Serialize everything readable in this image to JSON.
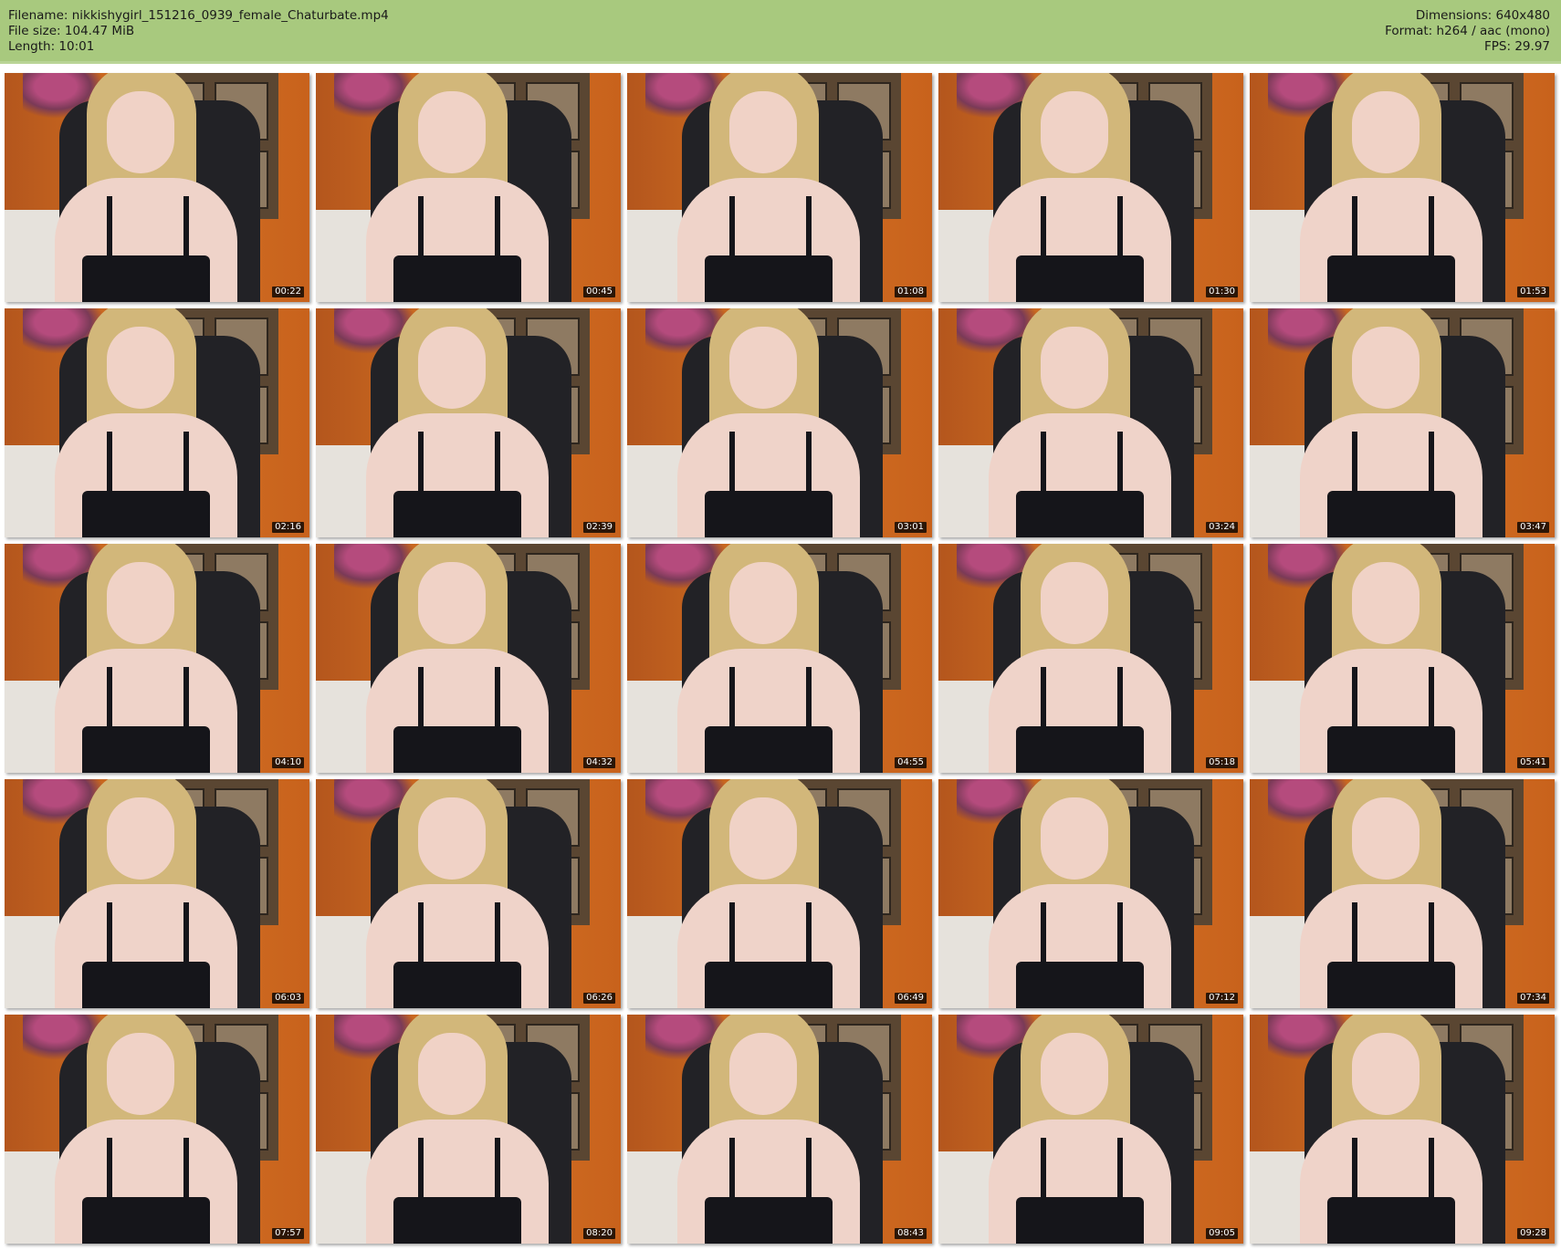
{
  "header": {
    "filename": "Filename: nikkishygirl_151216_0939_female_Chaturbate.mp4",
    "filesize": "File size: 104.47 MiB",
    "length": "Length: 10:01",
    "dimensions": "Dimensions: 640x480",
    "format": "Format: h264 / aac (mono)",
    "fps": "FPS: 29.97"
  },
  "colors": {
    "header_bg": "#a8c97e",
    "timestamp_bg": "#000000",
    "timestamp_text": "#ffffff"
  },
  "thumbnails": [
    {
      "timestamp": "00:22"
    },
    {
      "timestamp": "00:45"
    },
    {
      "timestamp": "01:08"
    },
    {
      "timestamp": "01:30"
    },
    {
      "timestamp": "01:53"
    },
    {
      "timestamp": "02:16"
    },
    {
      "timestamp": "02:39"
    },
    {
      "timestamp": "03:01"
    },
    {
      "timestamp": "03:24"
    },
    {
      "timestamp": "03:47"
    },
    {
      "timestamp": "04:10"
    },
    {
      "timestamp": "04:32"
    },
    {
      "timestamp": "04:55"
    },
    {
      "timestamp": "05:18"
    },
    {
      "timestamp": "05:41"
    },
    {
      "timestamp": "06:03"
    },
    {
      "timestamp": "06:26"
    },
    {
      "timestamp": "06:49"
    },
    {
      "timestamp": "07:12"
    },
    {
      "timestamp": "07:34"
    },
    {
      "timestamp": "07:57"
    },
    {
      "timestamp": "08:20"
    },
    {
      "timestamp": "08:43"
    },
    {
      "timestamp": "09:05"
    },
    {
      "timestamp": "09:28"
    }
  ]
}
